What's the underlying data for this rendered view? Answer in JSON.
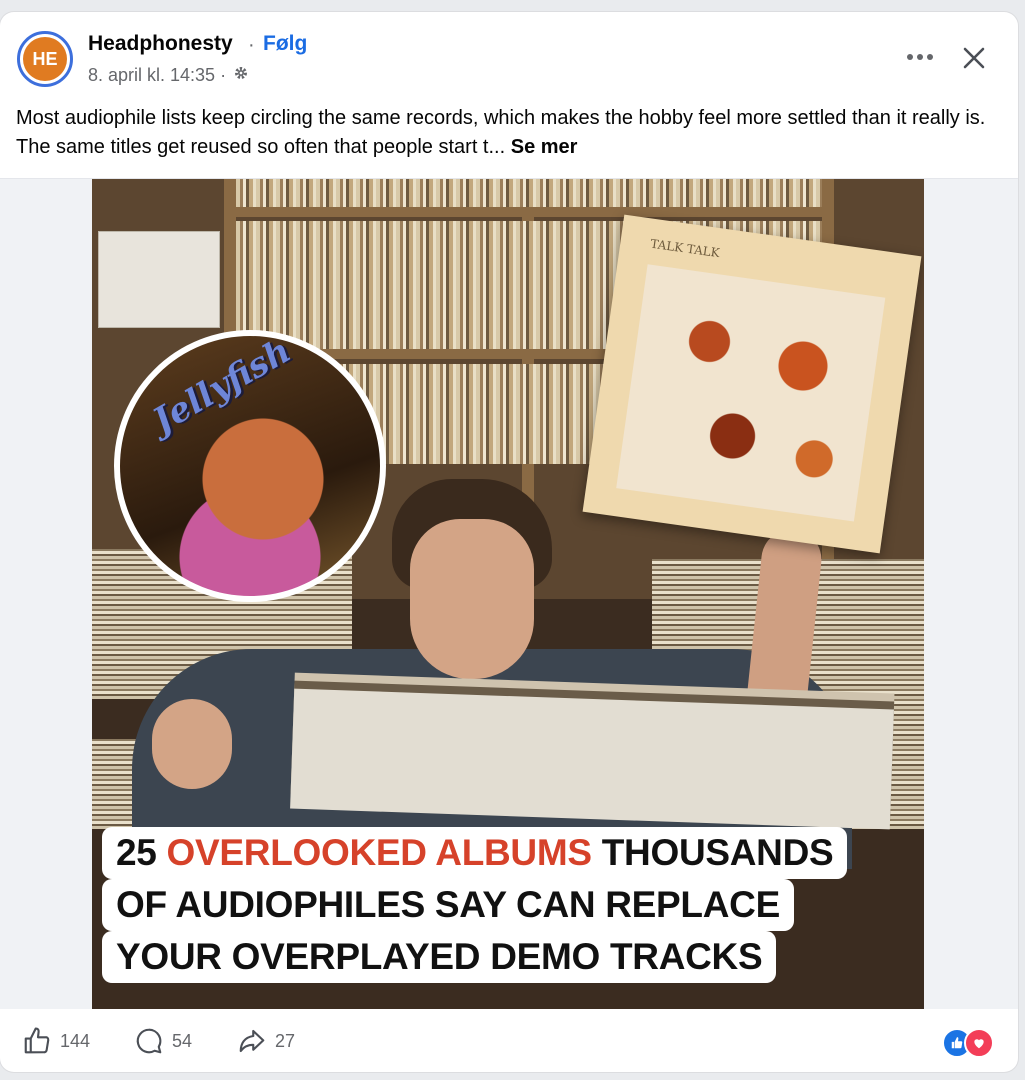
{
  "post": {
    "author": "Headphonesty",
    "separator": "·",
    "follow_label": "Følg",
    "date": "8. april kl. 14:35 ·",
    "avatar_letters": "HE",
    "text": "Most audiophile lists keep circling the same records, which makes the hobby feel more settled than it really is. The same titles get reused so often that people start t...",
    "see_more_label": "Se mer"
  },
  "media": {
    "album_right_label": "TALK TALK",
    "album_left_logo": "Jellyfish",
    "headline": {
      "line1_number": "25",
      "line1_accent": "OVERLOOKED ALBUMS",
      "line1_rest": "THOUSANDS",
      "line2": "OF AUDIOPHILES SAY CAN REPLACE",
      "line3": "YOUR OVERPLAYED DEMO TRACKS"
    },
    "accent_color": "#d6422a"
  },
  "footer": {
    "likes": "144",
    "comments": "54",
    "shares": "27"
  },
  "icons": {
    "more": "more-horizontal-icon",
    "close": "close-icon",
    "privacy": "gear-icon",
    "like": "thumbs-up-icon",
    "comment": "comment-icon",
    "share": "share-icon"
  },
  "colors": {
    "link": "#1b6ce3",
    "like_reaction": "#1b74e4",
    "love_reaction": "#f33e58"
  }
}
